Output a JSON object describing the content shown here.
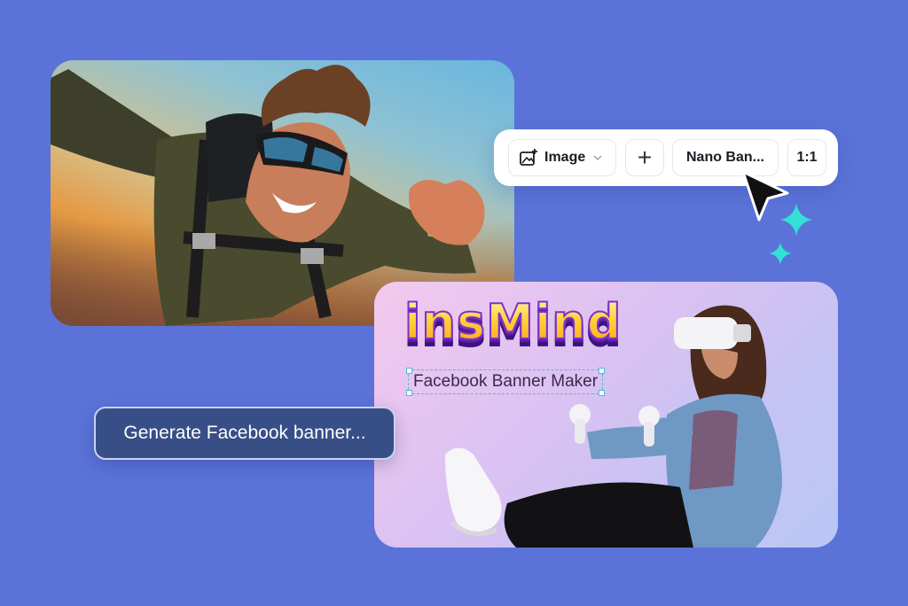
{
  "toolbar": {
    "type_label": "Image",
    "add_symbol": "+",
    "model_label": "Nano Ban...",
    "ratio_label": "1:1"
  },
  "banner": {
    "brand": "insMind",
    "subtitle": "Facebook Banner Maker"
  },
  "prompt": {
    "text": "Generate Facebook banner..."
  },
  "colors": {
    "background": "#5b73d9",
    "accent_sparkle": "#33e0d6",
    "prompt_bg": "#384e87",
    "brand_purple": "#7b2fd0"
  },
  "icons": [
    "image-plus-icon",
    "chevron-down-icon",
    "plus-icon",
    "cursor-icon",
    "sparkle-icon"
  ]
}
